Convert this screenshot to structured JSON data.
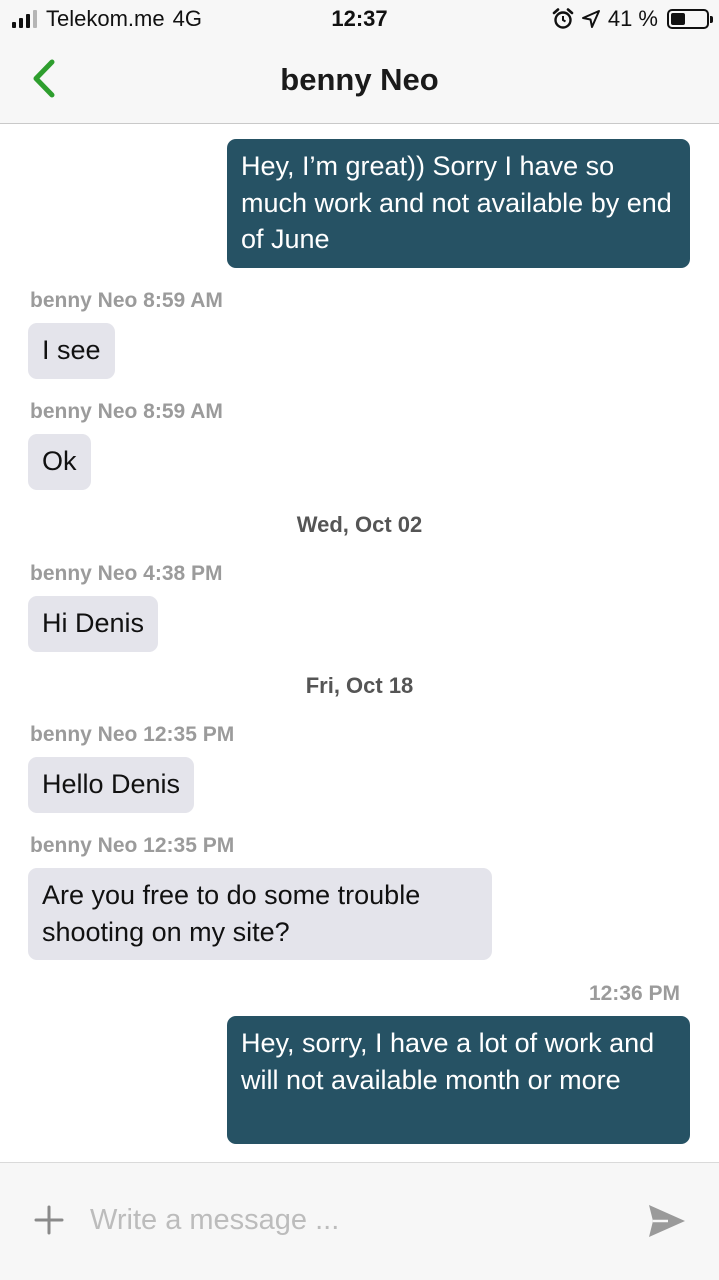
{
  "status_bar": {
    "carrier": "Telekom.me",
    "network": "4G",
    "time": "12:37",
    "battery": "41 %",
    "battery_level": 0.41,
    "icons": [
      "signal-icon",
      "alarm-icon",
      "location-arrow-icon",
      "battery-icon"
    ]
  },
  "header": {
    "back_icon": "chevron-left-icon",
    "title": "benny Neo",
    "accent_color": "#2e9e2e"
  },
  "messages": [
    {
      "kind": "bubble",
      "direction": "outgoing",
      "text": "Hey, I’m great)) Sorry I have so much work and not available by end of June"
    },
    {
      "kind": "meta",
      "text": "benny Neo 8:59 AM"
    },
    {
      "kind": "bubble",
      "direction": "incoming",
      "text": "I see"
    },
    {
      "kind": "meta",
      "text": "benny Neo 8:59 AM"
    },
    {
      "kind": "bubble",
      "direction": "incoming",
      "text": "Ok"
    },
    {
      "kind": "date",
      "text": "Wed, Oct 02"
    },
    {
      "kind": "meta",
      "text": "benny Neo 4:38 PM"
    },
    {
      "kind": "bubble",
      "direction": "incoming",
      "text": "Hi Denis"
    },
    {
      "kind": "date",
      "text": "Fri, Oct 18"
    },
    {
      "kind": "meta",
      "text": "benny Neo 12:35 PM"
    },
    {
      "kind": "bubble",
      "direction": "incoming",
      "text": "Hello Denis"
    },
    {
      "kind": "meta",
      "text": "benny Neo 12:35 PM"
    },
    {
      "kind": "bubble",
      "direction": "incoming",
      "text": "Are you free to do some trouble shooting on my site?"
    },
    {
      "kind": "meta",
      "text": "12:36 PM"
    },
    {
      "kind": "bubble",
      "direction": "outgoing",
      "text": "Hey, sorry, I have a lot of work and will not available month or more"
    }
  ],
  "colors": {
    "outgoing_bubble": "#265264",
    "incoming_bubble": "#e4e4eb"
  },
  "composer": {
    "add_icon": "plus-icon",
    "placeholder": "Write a message ...",
    "value": "",
    "send_icon": "send-icon"
  }
}
